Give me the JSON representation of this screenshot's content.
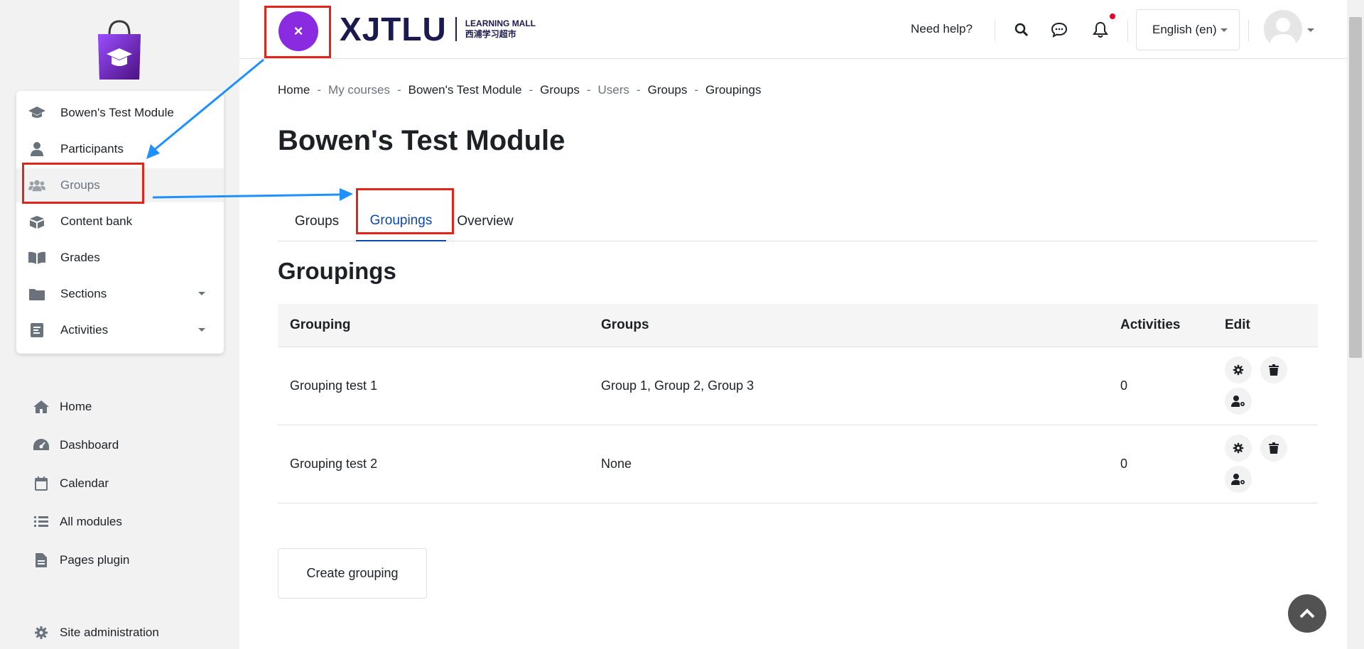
{
  "brand": {
    "name": "XJTLU",
    "sub_en": "LEARNING MALL",
    "sub_zh": "西浦学习超市",
    "close_label": "×"
  },
  "header": {
    "need_help": "Need help?",
    "language": "English (en)",
    "icons": [
      "search-icon",
      "chat-icon",
      "bell-icon",
      "avatar"
    ]
  },
  "course_menu": [
    {
      "label": "Bowen's Test Module",
      "icon": "graduation-cap-icon"
    },
    {
      "label": "Participants",
      "icon": "user-icon"
    },
    {
      "label": "Groups",
      "icon": "users-icon",
      "active": true
    },
    {
      "label": "Content bank",
      "icon": "box-icon"
    },
    {
      "label": "Grades",
      "icon": "book-icon"
    },
    {
      "label": "Sections",
      "icon": "folder-icon"
    },
    {
      "label": "Activities",
      "icon": "activity-icon"
    }
  ],
  "nav": [
    {
      "label": "Home",
      "icon": "home-icon"
    },
    {
      "label": "Dashboard",
      "icon": "dashboard-icon"
    },
    {
      "label": "Calendar",
      "icon": "calendar-icon"
    },
    {
      "label": "All modules",
      "icon": "list-icon"
    },
    {
      "label": "Pages plugin",
      "icon": "file-icon"
    },
    {
      "label": "Site administration",
      "icon": "gear-icon"
    }
  ],
  "breadcrumb": [
    {
      "label": "Home"
    },
    {
      "label": "My courses",
      "muted": true
    },
    {
      "label": "Bowen's Test Module"
    },
    {
      "label": "Groups"
    },
    {
      "label": "Users",
      "muted": true
    },
    {
      "label": "Groups"
    },
    {
      "label": "Groupings"
    }
  ],
  "breadcrumb_sep": "-",
  "page_title": "Bowen's Test Module",
  "tabs": [
    {
      "label": "Groups"
    },
    {
      "label": "Groupings",
      "active": true
    },
    {
      "label": "Overview"
    }
  ],
  "section_title": "Groupings",
  "table": {
    "headers": [
      "Grouping",
      "Groups",
      "Activities",
      "Edit"
    ],
    "rows": [
      {
        "grouping": "Grouping test 1",
        "groups": "Group 1, Group 2, Group 3",
        "activities": "0"
      },
      {
        "grouping": "Grouping test 2",
        "groups": "None",
        "activities": "0"
      }
    ]
  },
  "create_button": "Create grouping",
  "colors": {
    "accent": "#0f47ad",
    "brand_purple": "#8a2be2",
    "annotation_red": "#e3241b",
    "annotation_arrow": "#1e90ff"
  }
}
